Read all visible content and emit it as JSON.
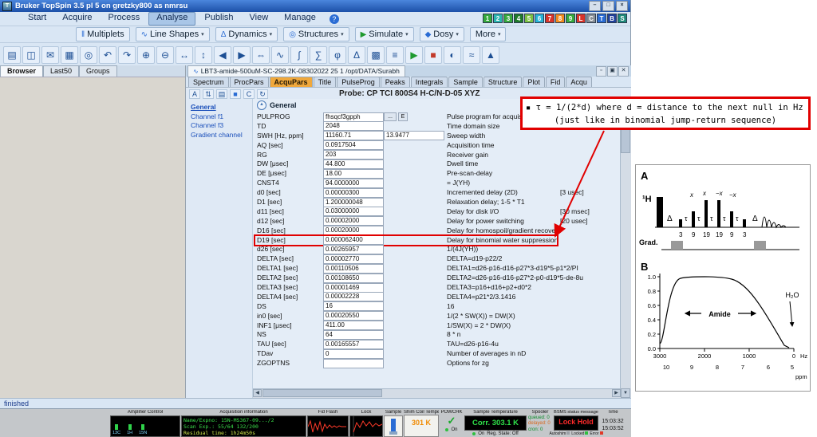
{
  "window": {
    "title": "Bruker TopSpin 3.5 pl 5 on gretzky800 as nmrsu",
    "controls": [
      "–",
      "□",
      "×"
    ]
  },
  "menubar": {
    "items": [
      "Start",
      "Acquire",
      "Process",
      "Analyse",
      "Publish",
      "View",
      "Manage"
    ],
    "active": "Analyse",
    "help": "?"
  },
  "workspace_buttons": [
    {
      "label": "1",
      "color": "#36a93c"
    },
    {
      "label": "2",
      "color": "#2ab5b0"
    },
    {
      "label": "3",
      "color": "#36a93c"
    },
    {
      "label": "4",
      "color": "#1f7a2a"
    },
    {
      "label": "5",
      "color": "#7cc142"
    },
    {
      "label": "6",
      "color": "#27b3d6"
    },
    {
      "label": "7",
      "color": "#d8342a"
    },
    {
      "label": "8",
      "color": "#f08a1e"
    },
    {
      "label": "9",
      "color": "#36a93c"
    },
    {
      "label": "L",
      "color": "#d8342a"
    },
    {
      "label": "C",
      "color": "#8a9096"
    },
    {
      "label": "T",
      "color": "#2a6cd4"
    },
    {
      "label": "B",
      "color": "#20409a"
    },
    {
      "label": "S",
      "color": "#1f8a7a"
    }
  ],
  "analyse_toolbar": {
    "buttons": [
      {
        "label": "Multiplets",
        "icon": "‖",
        "dropdown": false
      },
      {
        "label": "Line Shapes",
        "icon": "∿",
        "dropdown": true
      },
      {
        "label": "Dynamics",
        "icon": "Δ",
        "dropdown": true
      },
      {
        "label": "Structures",
        "icon": "◎",
        "dropdown": true
      },
      {
        "label": "Simulate",
        "icon": "▶",
        "icon_color": "#1f9a2f",
        "dropdown": true
      },
      {
        "label": "Dosy",
        "icon": "◆",
        "dropdown": true
      },
      {
        "label": "More",
        "icon": "",
        "dropdown": true
      }
    ]
  },
  "icon_toolbar": {
    "icons": [
      {
        "name": "open-dataset-icon",
        "glyph": "▤"
      },
      {
        "name": "save-icon",
        "glyph": "◫"
      },
      {
        "name": "email-icon",
        "glyph": "✉"
      },
      {
        "name": "print-icon",
        "glyph": "▦"
      },
      {
        "name": "search-icon",
        "glyph": "◎"
      },
      {
        "name": "undo-icon",
        "glyph": "↶"
      },
      {
        "name": "redo-icon",
        "glyph": "↷"
      },
      {
        "name": "zoom-in-icon",
        "glyph": "⊕"
      },
      {
        "name": "zoom-out-icon",
        "glyph": "⊖"
      },
      {
        "name": "expand-horizontal-icon",
        "glyph": "↔"
      },
      {
        "name": "expand-vertical-icon",
        "glyph": "↕"
      },
      {
        "name": "scroll-left-icon",
        "glyph": "◀"
      },
      {
        "name": "scroll-right-icon",
        "glyph": "▶"
      },
      {
        "name": "full-view-icon",
        "glyph": "⇔"
      },
      {
        "name": "fid-icon",
        "glyph": "∿"
      },
      {
        "name": "integral-icon",
        "glyph": "∫"
      },
      {
        "name": "sum-icon",
        "glyph": "∑"
      },
      {
        "name": "phase-icon",
        "glyph": "φ"
      },
      {
        "name": "calibrate-icon",
        "glyph": "Δ"
      },
      {
        "name": "grid-icon",
        "glyph": "▩"
      },
      {
        "name": "overlay-icon",
        "glyph": "≡"
      },
      {
        "name": "acquire-play-icon",
        "glyph": "▶",
        "color": "#1f9a2f"
      },
      {
        "name": "stop-icon",
        "glyph": "■",
        "color": "#c23a2a"
      },
      {
        "name": "lock-icon",
        "glyph": "◐"
      },
      {
        "name": "shim-icon",
        "glyph": "≈"
      },
      {
        "name": "chevron-up-icon",
        "glyph": "▲"
      }
    ]
  },
  "browser_panel": {
    "tabs": [
      "Browser",
      "Last50",
      "Groups"
    ],
    "active_tab": "Browser"
  },
  "dataset": {
    "tab_label": "LBT3-amide-500uM-SC-298.2K-08302022  25  1  /opt/DATA/Surabh",
    "controls": [
      "▫",
      "▣",
      "✕"
    ]
  },
  "param_tabs": {
    "items": [
      "Spectrum",
      "ProcPars",
      "AcquPars",
      "Title",
      "PulseProg",
      "Peaks",
      "Integrals",
      "Sample",
      "Structure",
      "Plot",
      "Fid",
      "Acqu"
    ],
    "active": "AcquPars"
  },
  "acqupars": {
    "toolbar_icons": [
      {
        "name": "font-icon",
        "glyph": "A"
      },
      {
        "name": "sort-icon",
        "glyph": "⇅"
      },
      {
        "name": "columns-icon",
        "glyph": "▤"
      },
      {
        "name": "source-blue-icon",
        "glyph": "■"
      },
      {
        "name": "copy-icon",
        "glyph": "C"
      },
      {
        "name": "refresh-icon",
        "glyph": "↻"
      }
    ],
    "probe": "Probe: CP TCI 800S4 H-C/N-D-05 XYZ",
    "sidebar": [
      {
        "label": "General",
        "active": true
      },
      {
        "label": "Channel f1",
        "active": false
      },
      {
        "label": "Channel f3",
        "active": false
      },
      {
        "label": "Gradient channel",
        "active": false
      }
    ],
    "section": "General",
    "rows": [
      {
        "name": "PULPROG",
        "value": "fhsqcf3gpph",
        "comment": "Pulse program for acquisition",
        "buttons": true
      },
      {
        "name": "TD",
        "value": "2048",
        "comment": "Time domain size"
      },
      {
        "name": "SWH [Hz, ppm]",
        "value": "11160.71",
        "value2": "13.9477",
        "comment": "Sweep width"
      },
      {
        "name": "AQ [sec]",
        "value": "0.0917504",
        "comment": "Acquisition time"
      },
      {
        "name": "RG",
        "value": "203",
        "comment": "Receiver gain"
      },
      {
        "name": "DW [μsec]",
        "value": "44.800",
        "comment": "Dwell time"
      },
      {
        "name": "DE [μsec]",
        "value": "18.00",
        "comment": "Pre-scan-delay"
      },
      {
        "name": "CNST4",
        "value": "94.0000000",
        "comment": "= J(YH)"
      },
      {
        "name": "d0 [sec]",
        "value": "0.00000300",
        "comment": "Incremented delay (2D)",
        "bracket": "[3 usec]"
      },
      {
        "name": "D1 [sec]",
        "value": "1.200000048",
        "comment": "Relaxation delay; 1-5 * T1"
      },
      {
        "name": "d11 [sec]",
        "value": "0.03000000",
        "comment": "Delay for disk I/O",
        "bracket": "[30 msec]"
      },
      {
        "name": "d12 [sec]",
        "value": "0.00002000",
        "comment": "Delay for power switching",
        "bracket": "[20 usec]"
      },
      {
        "name": "D16 [sec]",
        "value": "0.00020000",
        "comment": "Delay for homospoil/gradient recovery"
      },
      {
        "name": "D19 [sec]",
        "value": "0.000062400",
        "comment": "Delay for binomial water suppression",
        "highlight": true
      },
      {
        "name": "d26 [sec]",
        "value": "0.00265957",
        "comment": "1/(4J(YH))"
      },
      {
        "name": "DELTA [sec]",
        "value": "0.00002770",
        "comment": "DELTA=d19-p22/2"
      },
      {
        "name": "DELTA1 [sec]",
        "value": "0.00110506",
        "comment": "DELTA1=d26-p16-d16-p27*3-d19*5-p1*2/PI"
      },
      {
        "name": "DELTA2 [sec]",
        "value": "0.00108650",
        "comment": "DELTA2=d26-p16-d16-p27*2-p0-d19*5-de-8u"
      },
      {
        "name": "DELTA3 [sec]",
        "value": "0.00001469",
        "comment": "DELTA3=p16+d16+p2+d0*2"
      },
      {
        "name": "DELTA4 [sec]",
        "value": "0.00002228",
        "comment": "DELTA4=p21*2/3.1416"
      },
      {
        "name": "DS",
        "value": "16",
        "comment": "16"
      },
      {
        "name": "in0 [sec]",
        "value": "0.00020550",
        "comment": "1/(2 * SW(X)) = DW(X)"
      },
      {
        "name": "INF1 [μsec]",
        "value": "411.00",
        "comment": "1/SW(X) = 2 * DW(X)"
      },
      {
        "name": "NS",
        "value": "64",
        "comment": "8 * n"
      },
      {
        "name": "TAU [sec]",
        "value": "0.00165557",
        "comment": "TAU=d26-p16-4u"
      },
      {
        "name": "TDav",
        "value": "0",
        "comment": "Number of averages in nD"
      },
      {
        "name": "ZGOPTNS",
        "value": "",
        "comment": "Options for zg"
      }
    ]
  },
  "annotation": {
    "bullet": "▪",
    "line1": "τ = 1/(2*d) where d = distance to the next null in Hz",
    "line2": "(just like in binomial jump-return sequence)",
    "border_color": "#e10000"
  },
  "figure": {
    "a_label": "A",
    "b_label": "B",
    "channel_label": "¹H",
    "delay_label": "Δ",
    "tau_label": "τ",
    "grad_label": "Grad.",
    "phases": [
      "x",
      "x",
      "−x",
      "−x"
    ],
    "pulse_numbers": [
      "3",
      "9",
      "19",
      "19",
      "9",
      "3"
    ],
    "plot": {
      "yticks": [
        "1.0",
        "0.8",
        "0.6",
        "0.4",
        "0.2",
        "0.0"
      ],
      "xticks": [
        "3000",
        "2000",
        "1000",
        "0"
      ],
      "x_unit": "Hz",
      "ppm_ticks": [
        "10",
        "9",
        "8",
        "7",
        "6",
        "5"
      ],
      "ppm_unit": "ppm",
      "amide_label": "Amide",
      "water_label": "H₂O"
    }
  },
  "status_line": {
    "text": "finished"
  },
  "bottom": {
    "amplifier": {
      "title": "Amplifier Control",
      "channels": [
        "13C",
        "1H",
        "15N"
      ]
    },
    "acq_info": {
      "title": "Acquisition information",
      "line1": "Name/Expno: 15N-MS367-09.../2",
      "line2": "Scan Exp.:  55/64  132/200",
      "line3": "Residual time: 1h24m50s"
    },
    "fid_flash": {
      "title": "Fid Flash"
    },
    "lock": {
      "title": "Lock"
    },
    "sample": {
      "title": "Sample"
    },
    "shim": {
      "title": "Shim Coil Temperature",
      "value": "301 K"
    },
    "powchk": {
      "title": "POWCHK",
      "check": "✓",
      "status": "On"
    },
    "sample_temp": {
      "title": "Sample Temperature",
      "value": "Corr. 303.1 K",
      "status_left": "On",
      "status_right": "Reg. State: Off"
    },
    "spooler": {
      "title": "Spooler",
      "lines": [
        {
          "label": "queued:",
          "value": "0",
          "color": "#0a8a2a"
        },
        {
          "label": "delayed:",
          "value": "0",
          "color": "#d8681e"
        },
        {
          "label": "cron:",
          "value": "0",
          "color": "#0a8a2a"
        }
      ]
    },
    "bsms": {
      "title": "BSMS status message",
      "message": "Lock Hold",
      "indicators": [
        {
          "label": "Autoshim",
          "color": "#9aa0a6"
        },
        {
          "label": "Locked",
          "color": "#2fbf3f"
        },
        {
          "label": "Error",
          "color": "#e03a2a"
        }
      ]
    },
    "time": {
      "title": "Time",
      "line1": "15:03:32",
      "line2": "15:03:52"
    }
  },
  "colors": {
    "highlight_red": "#e10000",
    "led_green": "#2fe44a",
    "warn_orange": "#f08a00",
    "lock_red": "#ff2a2a"
  }
}
